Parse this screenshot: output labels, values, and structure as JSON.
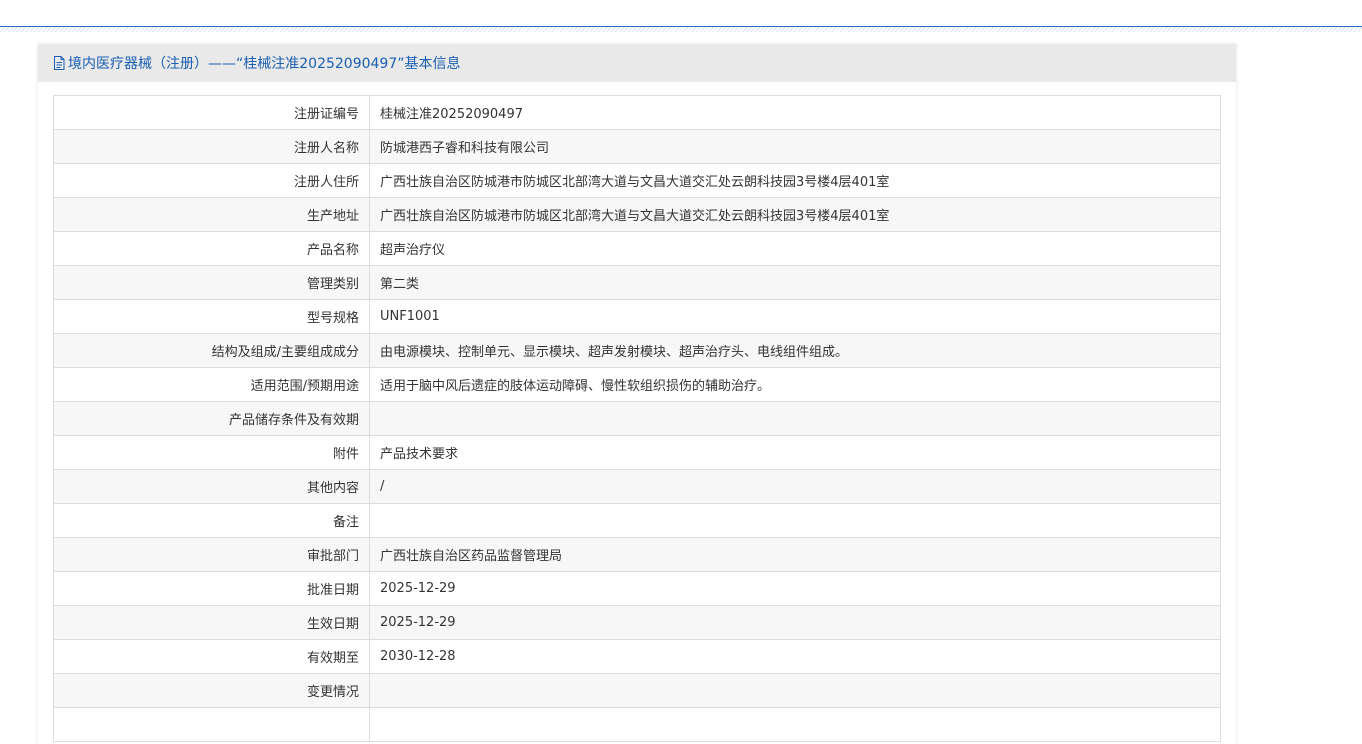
{
  "header": {
    "title": "境内医疗器械（注册）——“桂械注准20252090497”基本信息",
    "icon": "document-icon",
    "title_color": "#1a5fb4"
  },
  "rows": [
    {
      "label": "注册证编号",
      "value": "桂械注准20252090497"
    },
    {
      "label": "注册人名称",
      "value": "防城港西子睿和科技有限公司"
    },
    {
      "label": "注册人住所",
      "value": "广西壮族自治区防城港市防城区北部湾大道与文昌大道交汇处云朗科技园3号楼4层401室"
    },
    {
      "label": "生产地址",
      "value": "广西壮族自治区防城港市防城区北部湾大道与文昌大道交汇处云朗科技园3号楼4层401室"
    },
    {
      "label": "产品名称",
      "value": "超声治疗仪"
    },
    {
      "label": "管理类别",
      "value": "第二类"
    },
    {
      "label": "型号规格",
      "value": "UNF1001"
    },
    {
      "label": "结构及组成/主要组成成分",
      "value": "由电源模块、控制单元、显示模块、超声发射模块、超声治疗头、电线组件组成。"
    },
    {
      "label": "适用范围/预期用途",
      "value": "适用于脑中风后遗症的肢体运动障碍、慢性软组织损伤的辅助治疗。"
    },
    {
      "label": "产品储存条件及有效期",
      "value": ""
    },
    {
      "label": "附件",
      "value": "产品技术要求"
    },
    {
      "label": "其他内容",
      "value": "/"
    },
    {
      "label": "备注",
      "value": ""
    },
    {
      "label": "审批部门",
      "value": "广西壮族自治区药品监督管理局"
    },
    {
      "label": "批准日期",
      "value": "2025-12-29"
    },
    {
      "label": "生效日期",
      "value": "2025-12-29"
    },
    {
      "label": "有效期至",
      "value": "2030-12-28"
    },
    {
      "label": "变更情况",
      "value": ""
    },
    {
      "label": "",
      "value": ""
    }
  ]
}
